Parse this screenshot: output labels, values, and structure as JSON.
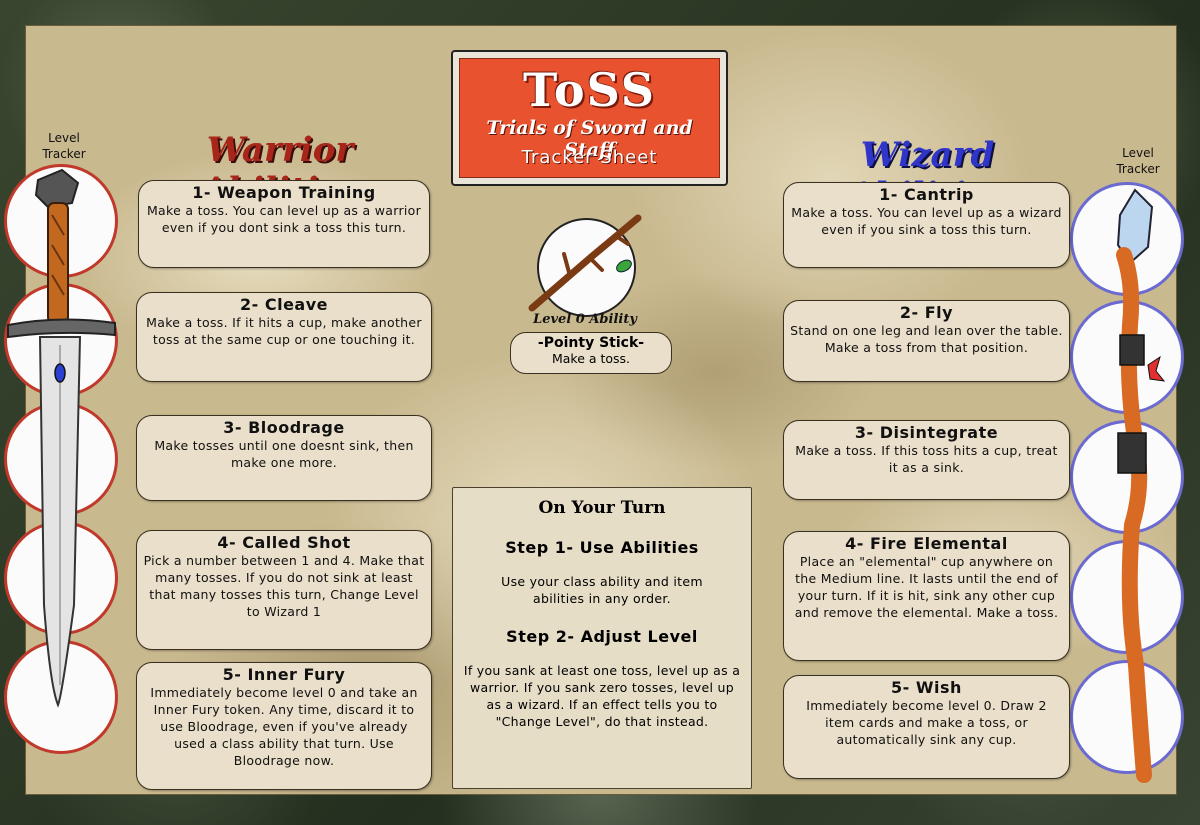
{
  "title": {
    "main": "ToSS",
    "sub": "Trials of Sword and Staff",
    "sub2": "Tracker Sheet"
  },
  "warrior": {
    "heading": "Warrior Abilities",
    "tracker_label": "Level Tracker",
    "abilities": [
      {
        "title": "1- Weapon Training",
        "body": "Make a toss. You can level up as a warrior even if you dont sink a toss this turn."
      },
      {
        "title": "2- Cleave",
        "body": "Make a toss. If it hits a cup, make another toss at the same cup or one touching it."
      },
      {
        "title": "3- Bloodrage",
        "body": "Make tosses until one doesnt sink, then make one more."
      },
      {
        "title": "4- Called Shot",
        "body": "Pick a number between 1 and 4. Make that many tosses. If you do not sink at least that many tosses this turn, Change Level to Wizard 1"
      },
      {
        "title": "5- Inner Fury",
        "body": "Immediately become level 0 and take an Inner Fury token. Any time, discard it to use Bloodrage, even if you've already used a class ability that turn. Use Bloodrage now."
      }
    ]
  },
  "wizard": {
    "heading": "Wizard Abilities",
    "tracker_label": "Level Tracker",
    "abilities": [
      {
        "title": "1- Cantrip",
        "body": "Make a toss. You can level up as a wizard even if you sink a toss this turn."
      },
      {
        "title": "2- Fly",
        "body": "Stand on one leg and lean over the table. Make a toss from that position."
      },
      {
        "title": "3- Disintegrate",
        "body": "Make a toss. If this toss hits a cup, treat it as a sink."
      },
      {
        "title": "4- Fire Elemental",
        "body": "Place an \"elemental\" cup anywhere on the Medium line. It lasts until the end of your turn. If it is hit, sink any other cup and remove the elemental. Make a toss."
      },
      {
        "title": "5- Wish",
        "body": "Immediately become level 0. Draw 2 item cards and make a toss, or automatically sink any cup."
      }
    ]
  },
  "level0": {
    "label": "Level 0 Ability",
    "title": "-Pointy Stick-",
    "body": "Make a toss."
  },
  "turn": {
    "heading": "On Your Turn",
    "step1_title": "Step 1- Use Abilities",
    "step1_body": "Use your class ability and item abilities in any order.",
    "step2_title": "Step 2- Adjust Level",
    "step2_body": "If you sank at least one toss, level up as a warrior. If you sank zero tosses, level up as a wizard. If an effect tells you to \"Change Level\",  do that instead."
  },
  "colors": {
    "warrior": "#a8251a",
    "wizard": "#3035c9",
    "title_bg": "#e9522e",
    "parchment": "#c9b98f"
  },
  "icons": {
    "warrior_tracker": "sword-icon",
    "wizard_tracker": "staff-icon",
    "level0": "stick-icon"
  }
}
